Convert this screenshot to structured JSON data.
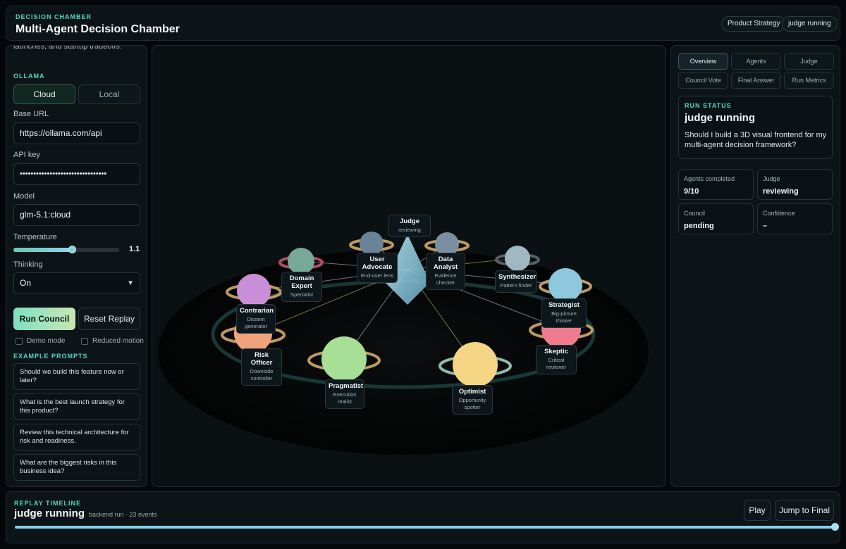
{
  "header": {
    "eyebrow": "DECISION CHAMBER",
    "title": "Multi-Agent Decision Chamber",
    "badges": [
      "Product Strategy",
      "judge running"
    ]
  },
  "sidebar": {
    "intro": "launches, and startup tradeoffs.",
    "ollama_heading": "OLLAMA",
    "mode_options": [
      "Cloud",
      "Local"
    ],
    "mode_selected": "Cloud",
    "base_url_label": "Base URL",
    "base_url_value": "https://ollama.com/api",
    "api_key_label": "API key",
    "api_key_value": "••••••••••••••••••••••••••••••••",
    "model_label": "Model",
    "model_value": "glm-5.1:cloud",
    "temperature_label": "Temperature",
    "temperature_value": "1.1",
    "temperature_fraction": 0.55,
    "thinking_label": "Thinking",
    "thinking_value": "On",
    "run_button": "Run Council",
    "reset_button": "Reset Replay",
    "demo_mode_label": "Demo mode",
    "demo_mode_checked": false,
    "reduced_motion_label": "Reduced motion",
    "reduced_motion_checked": false,
    "examples_heading": "EXAMPLE PROMPTS",
    "example_prompts": [
      "Should we build this feature now or later?",
      "What is the best launch strategy for this product?",
      "Review this technical architecture for risk and readiness.",
      "What are the biggest risks in this business idea?"
    ]
  },
  "scene": {
    "judge": {
      "name": "Judge",
      "status": "reviewing"
    },
    "agents": [
      {
        "name": "User Advocate",
        "role": "End-user lens",
        "color": "#6b8399"
      },
      {
        "name": "Data Analyst",
        "role": "Evidence checker",
        "color": "#7a8fa0"
      },
      {
        "name": "Domain Expert",
        "role": "Specialist",
        "color": "#78a898"
      },
      {
        "name": "Synthesizer",
        "role": "Pattern finder",
        "color": "#9fb8c4"
      },
      {
        "name": "Contrarian",
        "role": "Dissent generator",
        "color": "#c98ed8"
      },
      {
        "name": "Strategist",
        "role": "Big-picture thinker",
        "color": "#8dc8dc"
      },
      {
        "name": "Risk Officer",
        "role": "Downside controller",
        "color": "#f0a27a"
      },
      {
        "name": "Skeptic",
        "role": "Critical reviewer",
        "color": "#f07b8e"
      },
      {
        "name": "Pragmatist",
        "role": "Execution realist",
        "color": "#a6df95"
      },
      {
        "name": "Optimist",
        "role": "Opportunity spotter",
        "color": "#f3d583"
      }
    ]
  },
  "right": {
    "tabs": [
      "Overview",
      "Agents",
      "Judge",
      "Council Vote",
      "Final Answer",
      "Run Metrics"
    ],
    "active_tab": "Overview",
    "run_status_heading": "RUN STATUS",
    "run_status": "judge running",
    "question": "Should I build a 3D visual frontend for my multi-agent decision framework?",
    "stats": [
      {
        "label": "Agents completed",
        "value": "9/10"
      },
      {
        "label": "Judge",
        "value": "reviewing"
      },
      {
        "label": "Council",
        "value": "pending"
      },
      {
        "label": "Confidence",
        "value": "–"
      }
    ]
  },
  "timeline": {
    "heading": "REPLAY TIMELINE",
    "title": "judge running",
    "subtitle": "backend run · 23 events",
    "play_button": "Play",
    "jump_button": "Jump to Final",
    "progress_fraction": 1.0
  }
}
